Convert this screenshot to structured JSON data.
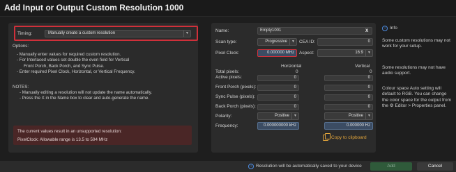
{
  "window": {
    "title": "Add Input or Output Custom Resolution 1000"
  },
  "timing": {
    "label": "Timing:",
    "value": "Manually create a custom resolution"
  },
  "options": {
    "heading": "Options:",
    "lines": [
      "- Manually enter values for required custom resolution.",
      "- For Interlaced values set double the even field for Vertical",
      "Front Porch, Back Porch, and Sync Pulse.",
      "- Enter required Pixel Clock, Horizontal, or Vertical Frequency."
    ]
  },
  "notes": {
    "heading": "NOTES:",
    "lines": [
      "- Manually editing a resolution will not update the name automatically.",
      "- Press the X in the Name box to clear and auto-generate the name."
    ]
  },
  "error": {
    "line1": "The current values result in an unsupported resolution:",
    "line2": "PixelClock: Allowable range is 13.5 to 594 MHz"
  },
  "form": {
    "name_label": "Name:",
    "name_value": "Empty1001",
    "clear_glyph": "X",
    "scan_label": "Scan type:",
    "scan_value": "Progressive",
    "cea_label": "CEA ID:",
    "cea_value": "0",
    "pixel_label": "Pixel Clock:",
    "pixel_value": "0.000000 MHz",
    "aspect_label": "Aspect:",
    "aspect_value": "16:9",
    "horizontal": "Horizontal",
    "vertical": "Vertical",
    "total_label": "Total pixels:",
    "total_h": "0",
    "total_v": "0",
    "active_label": "Active pixels:",
    "active_h": "0",
    "active_v": "0",
    "front_label": "Front Porch (pixels):",
    "front_h": "0",
    "front_v": "0",
    "sync_label": "Sync Pulse (pixels):",
    "sync_h": "0",
    "sync_v": "0",
    "back_label": "Back Porch (pixels):",
    "back_h": "0",
    "back_v": "0",
    "polarity_label": "Polarity:",
    "polarity_h": "Positive",
    "polarity_v": "Positive",
    "freq_label": "Frequency:",
    "freq_h": "0.000000000 kHz",
    "freq_v": "0.000000 Hz",
    "copy": "Copy to clipboard"
  },
  "info": {
    "title": "Info",
    "p1": "Some custom resolutions may not work for your setup.",
    "p2": "Some resolutions may not have audio support.",
    "p3": "Colour space Auto setting will default to RGB. You can change the color space for the output from the ⚙ Editor > Properties panel."
  },
  "footer": {
    "notice": "Resolution will be automatically saved to your device",
    "add": "Add",
    "cancel": "Cancel"
  },
  "colors": {
    "accent": "#4d8ee6",
    "error_bg": "#4a2626",
    "highlight": "#d0303a",
    "copy": "#e4a63b",
    "add_btn": "#2f5a3a"
  }
}
